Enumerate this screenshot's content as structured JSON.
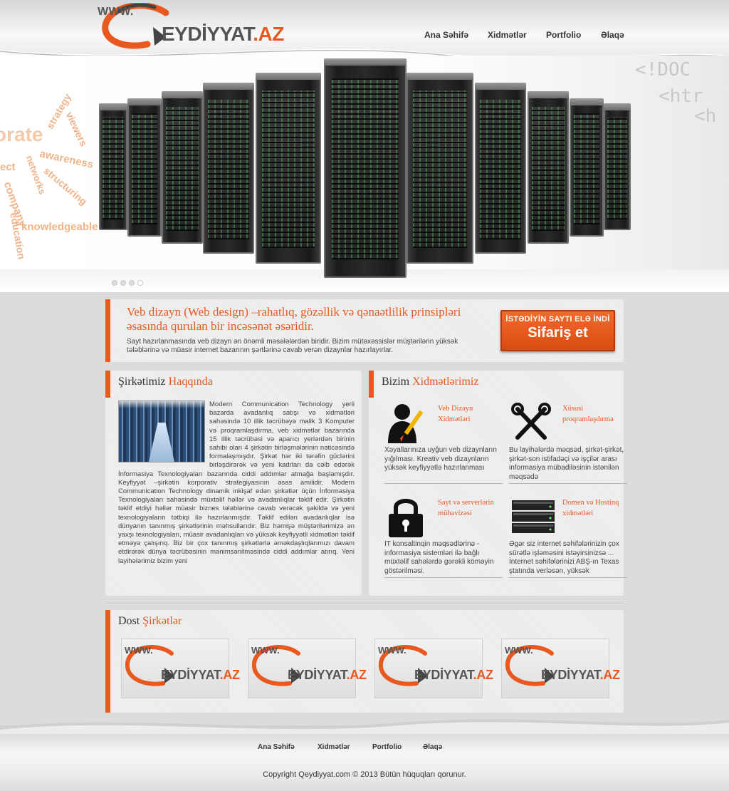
{
  "brand": {
    "www": "WWW.",
    "name": "EYDİYYAT",
    "tld": ".AZ",
    "accent": "#e8581f"
  },
  "nav": {
    "home": "Ana Səhifə",
    "services": "Xidmətlər",
    "portfolio": "Portfolio",
    "contact": "Əlaqə"
  },
  "hero": {
    "cloud_words": [
      "orate",
      "strategy",
      "viewers",
      "ect",
      "networks",
      "awareness",
      "structuring",
      "company",
      "education",
      "knowledgeable"
    ],
    "code_lines": [
      "<!DOC",
      "<htr",
      "<h"
    ],
    "slides": 4,
    "active_slide": 4
  },
  "intro": {
    "title": "Veb dizayn (Web design) –rahatlıq, gözəllik və qənaətlilik prinsipləri əsasında qurulan bir incəsənət əsəridir.",
    "text": "Sayt hazırlanmasında veb dizayn ən önəmli məsələlərdən biridir. Bizim mütəxəssislər müştərilərin yüksək tələblərinə və müasir internet bazarının şərtlərinə cavab verən dizaynlar hazırlayırlar.",
    "button_small": "İSTƏDİYİN SAYTI ELƏ İNDİ",
    "button_big": "Sifariş et"
  },
  "about": {
    "title_1": "Şirkətimiz",
    "title_2": "Haqqında",
    "text": "Modern Communication Technology yerli bazarda avadanlıq satışı və xidmətləri sahəsində 10 illik təcrübəyə malik 3 Komputer və proqramlaşdırma, veb xidmətlər bazarında 15 illik təcrübəsi və aparıcı yerlərdən birinin sahibi olan 4 şirkətin birləşmələrinin nəticəsində formalaşmışdır. Şirkət hər iki tərəfin güclərini birləşdirərək və yeni kadrları da cəlb edərək İnformasiya Texnologiyaları bazarında ciddi addımlar atmağa başlamışdır. Keyfiyyət –şirkətin korporativ strategiyasının əsas amilidir. Modern Communication Technology dinamik inkişaf edən şirkətlər üçün İnformasiya Texnologiyaları sahəsində müxtəlif həllər və avadanlıqlar təklif edir. Şirkətin təklif etdiyi həllər müasir biznes tələblərinə cavab verəcək şəkildə və yeni texnologiyaların tətbiqi ilə hazırlanmışdır. Təklif edilən avadanlıqlar isə dünyanın tanınmış şirkətlərinin məhsullarıdır. Biz həmişə müştərilərimizə ən yaxşı texnologiyaları, müasir avadanlıqları və yüksək keyfiyyətli xidmətləri təklif etməyə çalışırıq. Biz bir çox tanınmış şirkətlərlə əməkdaşlıqlarımızı davam etdirərək dünya təcrübəsinin mənimsənilməsində ciddi addımlar atırıq. Yeni layihələrimiz bizim yeni"
  },
  "services": {
    "title_1": "Bizim",
    "title_2": "Xidmətlərimiz",
    "items": [
      {
        "name": "Veb Dizayn Xidmətləri",
        "desc": "Xəyallarınıza uyğun veb dizaynların yığılması. Kreativ veb dizaynların yüksək keyfiyyətlə hazırlanması",
        "icon": "web-designer-icon"
      },
      {
        "name": "Xüsusi proqramlaşdırma",
        "desc": "Bu layihələrdə məqsəd, şirkət-şirkət, şirkət-son istifadəçi və işçilər arası informasiya mübadiləsinin istənilən məqsədə",
        "icon": "tools-icon"
      },
      {
        "name": "Sayt və serverlərin mühavizəsi",
        "desc": "İT konsaltinqin məqsədlərinə - informasiya sistemləri ilə bağlı müxtəlif sahələrdə gərəkli köməyin göstərilməsi.",
        "icon": "lock-icon"
      },
      {
        "name": "Domen və Hostinq xidmətləri",
        "desc": "Əgər siz internet səhifələrinizin çox sürətlə işləməsini istəyirsinizsə ... İnternet səhifələrinizi ABŞ-ın Texas ştatında verləsən, yüksək",
        "icon": "server-icon"
      }
    ]
  },
  "partners": {
    "title_1": "Dost",
    "title_2": "Şirkətlər",
    "items": [
      {
        "www": "WWW.",
        "name": "EYDİYYAT",
        "tld": ".AZ"
      },
      {
        "www": "WWW.",
        "name": "EYDİYYAT",
        "tld": ".AZ"
      },
      {
        "www": "WWW.",
        "name": "EYDİYYAT",
        "tld": ".AZ"
      },
      {
        "www": "WWW.",
        "name": "EYDİYYAT",
        "tld": ".AZ"
      }
    ]
  },
  "footer": {
    "nav": {
      "home": "Ana Səhifə",
      "services": "Xidmətlər",
      "portfolio": "Portfolio",
      "contact": "Əlaqə"
    },
    "copyright": "Copyright Qeydiyyat.com © 2013 Bütün hüquqları qorunur."
  }
}
